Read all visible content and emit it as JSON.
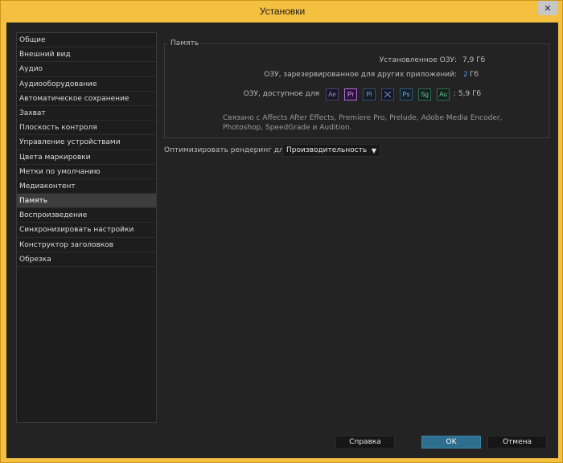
{
  "window": {
    "title": "Установки"
  },
  "sidebar": {
    "items": [
      {
        "label": "Общие"
      },
      {
        "label": "Внешний вид"
      },
      {
        "label": "Аудио"
      },
      {
        "label": "Аудиооборудование"
      },
      {
        "label": "Автоматическое сохранение"
      },
      {
        "label": "Захват"
      },
      {
        "label": "Плоскость контроля"
      },
      {
        "label": "Управление устройствами"
      },
      {
        "label": "Цвета маркировки"
      },
      {
        "label": "Метки по умолчанию"
      },
      {
        "label": "Медиаконтент"
      },
      {
        "label": "Память"
      },
      {
        "label": "Воспроизведение"
      },
      {
        "label": "Синхронизировать настройки"
      },
      {
        "label": "Конструктор заголовков"
      },
      {
        "label": "Обрезка"
      }
    ],
    "selected_label": "Память"
  },
  "memory": {
    "group_title": "Память",
    "installed_label": "Установленное ОЗУ:",
    "installed_value": "7,9 Гб",
    "reserved_label": "ОЗУ, зарезервированное для других приложений:",
    "reserved_value": "2",
    "reserved_unit": "Гб",
    "available_label": "ОЗУ, доступное для",
    "available_value": ":  5,9 Гб",
    "apps": [
      {
        "abbr": "Ae",
        "color": "#9b8ac9"
      },
      {
        "abbr": "Pr",
        "color": "#e6a4ff"
      },
      {
        "abbr": "Pl",
        "color": "#7d9ec7"
      },
      {
        "abbr": "",
        "color": "#7f8fc4"
      },
      {
        "abbr": "Ps",
        "color": "#6cb4e6"
      },
      {
        "abbr": "Sg",
        "color": "#6fc6a8"
      },
      {
        "abbr": "Au",
        "color": "#6fcf9b"
      }
    ],
    "note": "Связано с Affects After Effects, Premiere Pro, Prelude, Adobe Media Encoder, Photoshop, SpeedGrade и Audition."
  },
  "render": {
    "label": "Оптимизировать рендеринг для:",
    "value": "Производительность"
  },
  "buttons": {
    "help": "Справка",
    "ok": "OK",
    "cancel": "Отмена"
  }
}
